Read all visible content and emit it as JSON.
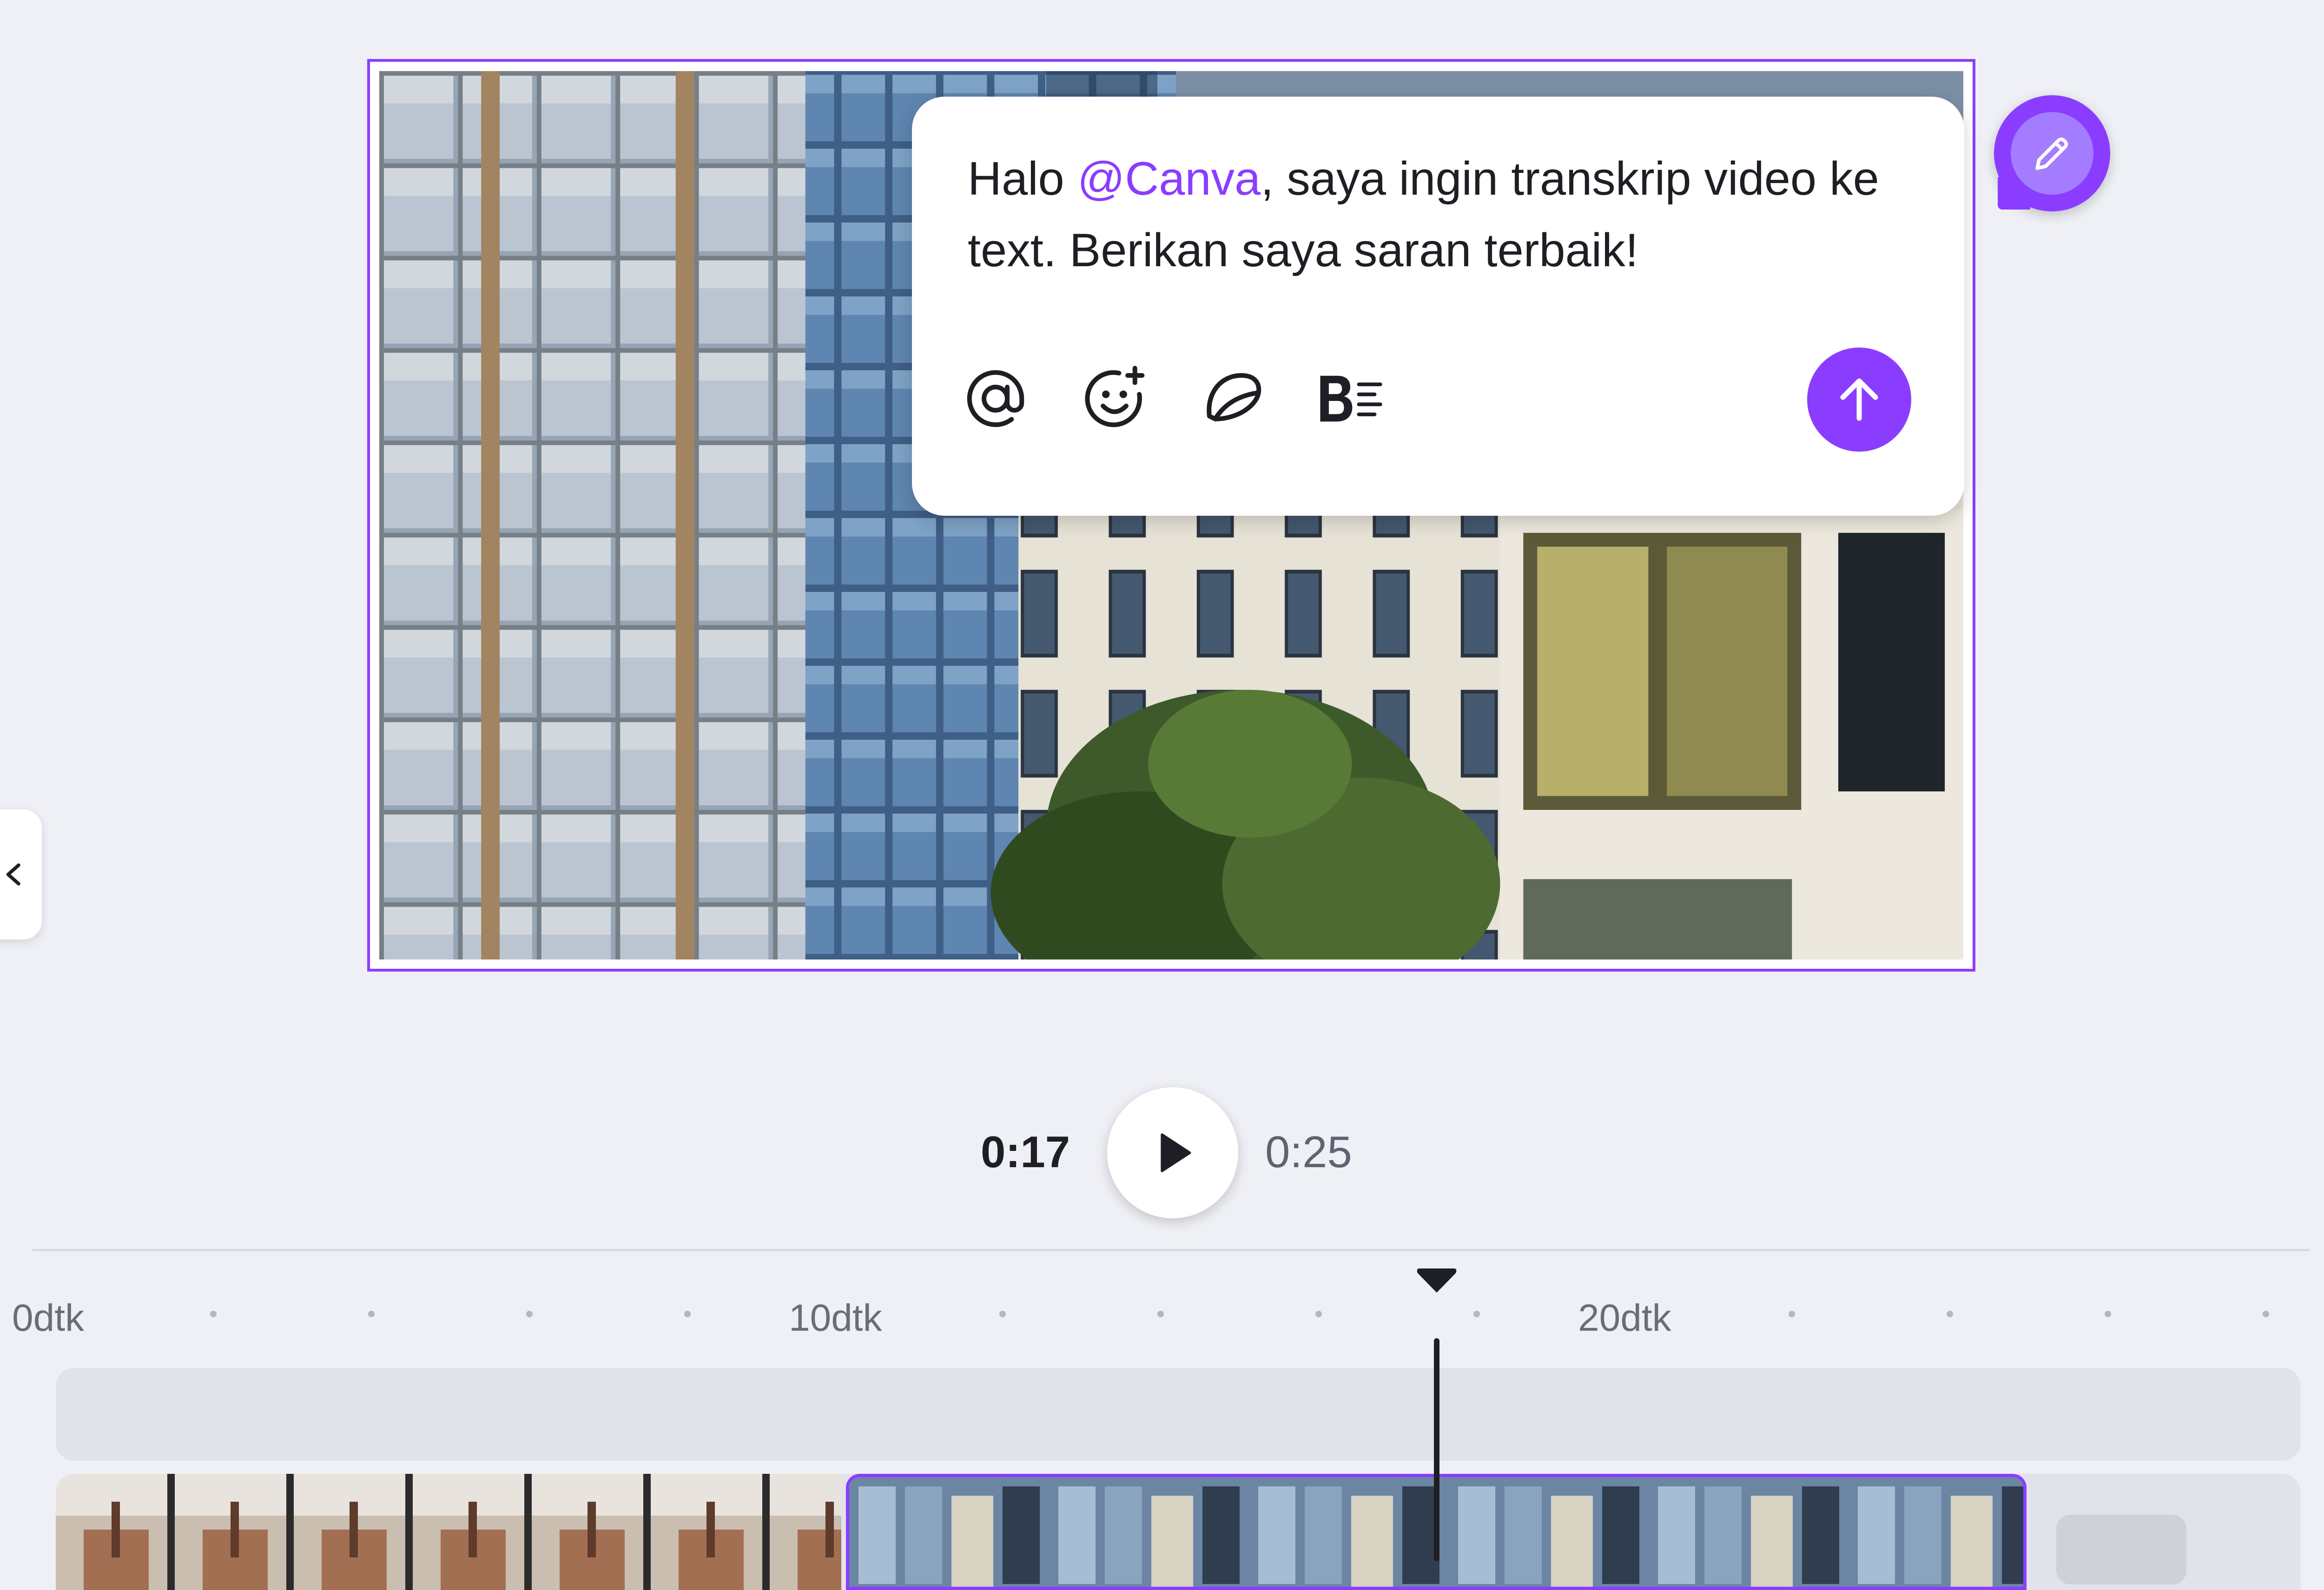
{
  "prompt": {
    "text_before": "Halo ",
    "mention": "@Canva",
    "text_after": ", saya ingin transkrip video ke text. Berikan saya saran terbaik!",
    "tools": [
      "at-sign-icon",
      "add-emoji-icon",
      "sticker-icon",
      "text-style-icon"
    ],
    "send_icon": "arrow-up-icon"
  },
  "edit_bubble_icon": "pencil-icon",
  "side_panel_icon": "chevron-left-icon",
  "playback": {
    "current_time": "0:17",
    "total_time": "0:25",
    "progress": 0.68,
    "play_icon": "play-icon"
  },
  "timeline": {
    "ruler_labels": [
      "0dtk",
      "10dtk",
      "20dtk"
    ],
    "playhead_icon": "playhead-marker-icon"
  },
  "colors": {
    "accent": "#8b3dff",
    "background": "#eff0f5",
    "track": "#e2e3ea",
    "text": "#1e1f24"
  }
}
